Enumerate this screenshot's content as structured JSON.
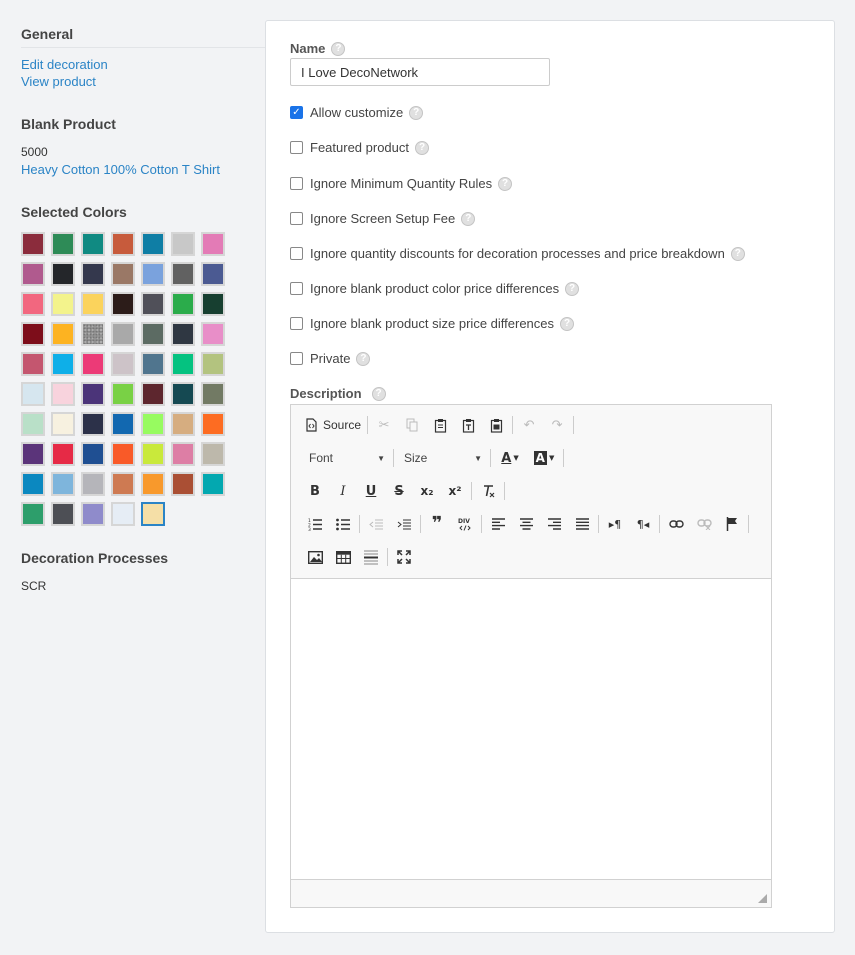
{
  "sidebar": {
    "general_heading": "General",
    "links": [
      "Edit decoration",
      "View product"
    ],
    "blank_heading": "Blank Product",
    "product_code": "5000",
    "product_name": "Heavy Cotton 100% Cotton T Shirt",
    "colors_heading": "Selected Colors",
    "colors": [
      "#8b2c3c",
      "#2e8b57",
      "#108a82",
      "#c75b3c",
      "#0f7ea5",
      "#c8c8c8",
      "#e37bb6",
      "#b05a8e",
      "#24262a",
      "#34384d",
      "#9a7866",
      "#7aa2dd",
      "#616161",
      "#4b5a92",
      "#f2677f",
      "#f3f38c",
      "#fbd35c",
      "#2c1c19",
      "#505059",
      "#2bac4b",
      "#173f30",
      "#7d0d1a",
      "#fdb321",
      "heather",
      "#a9a9a9",
      "#5c6b63",
      "#2f3742",
      "#e88ec8",
      "#c4566f",
      "#0eafe8",
      "#ec3a77",
      "#cdc3c8",
      "#50758e",
      "#05c280",
      "#b3c37f",
      "#d6e6ef",
      "#f8d3dd",
      "#4b3479",
      "#79d145",
      "#5d262e",
      "#154952",
      "#727a64",
      "#b9e0c8",
      "#f7f1e0",
      "#2c3149",
      "#1268b0",
      "#97fb60",
      "#d6ad80",
      "#fd6c22",
      "#5b347a",
      "#e62a46",
      "#1f4f92",
      "#f95a28",
      "#c9e93b",
      "#dd7ea5",
      "#bdb8ab",
      "#0b88c0",
      "#7eb5dc",
      "#b5b5ba",
      "#ce7a52",
      "#f8992c",
      "#aa4f34",
      "#03a8b0",
      "#2d9e6b",
      "#4d4f55",
      "#8f8bcb",
      "#e6edf5",
      "#f5dfa7"
    ],
    "selected_index": 67,
    "processes_heading": "Decoration Processes",
    "process": "SCR"
  },
  "form": {
    "name_label": "Name",
    "name_value": "I Love DecoNetwork",
    "help_glyph": "?",
    "checkboxes": [
      {
        "label": "Allow customize",
        "checked": true
      },
      {
        "label": "Featured product",
        "checked": false
      },
      {
        "label": "Ignore Minimum Quantity Rules",
        "checked": false
      },
      {
        "label": "Ignore Screen Setup Fee",
        "checked": false
      },
      {
        "label": "Ignore quantity discounts for decoration processes and price breakdown",
        "checked": false
      },
      {
        "label": "Ignore blank product color price differences",
        "checked": false
      },
      {
        "label": "Ignore blank product size price differences",
        "checked": false
      },
      {
        "label": "Private",
        "checked": false
      }
    ],
    "description_label": "Description"
  },
  "editor": {
    "source_label": "Source",
    "font_label": "Font",
    "size_label": "Size",
    "bold": "B",
    "italic": "I",
    "underline": "U",
    "strike": "S",
    "sub": "x₂",
    "sup": "x²",
    "text_color": "A",
    "bg_color": "A"
  }
}
